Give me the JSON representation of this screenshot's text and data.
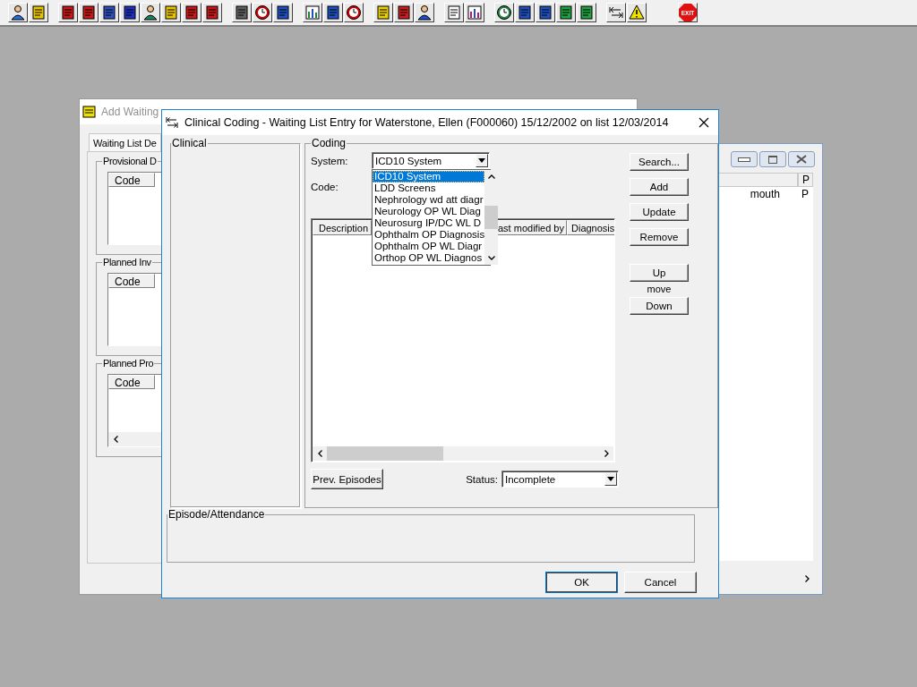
{
  "toolbar": {
    "exit_label": "EXIT"
  },
  "background_window": {
    "title": "Add Waiting",
    "tab": {
      "label": "Waiting List De",
      "selected": true
    },
    "groups": [
      {
        "title": "Provisional D",
        "column": "Code"
      },
      {
        "title": "Planned Inv",
        "column": "Code"
      },
      {
        "title": "Planned Pro",
        "column": "Code"
      }
    ]
  },
  "right_window": {
    "header": "P",
    "rows": [
      {
        "cells": [
          "mouth",
          "P"
        ]
      }
    ]
  },
  "dialog": {
    "title": "Clinical Coding - Waiting List Entry for Waterstone, Ellen (F000060) 15/12/2002 on list 12/03/2014",
    "clinical_label": "Clinical",
    "coding_label": "Coding",
    "system": {
      "label": "System:",
      "value": "ICD10 System",
      "options": [
        {
          "label": "ICD10 System",
          "selected": true
        },
        {
          "label": "LDD Screens",
          "selected": false
        },
        {
          "label": "Nephrology wd att diagr",
          "selected": false
        },
        {
          "label": "Neurology OP WL Diag",
          "selected": false
        },
        {
          "label": "Neurosurg IP/DC WL D",
          "selected": false
        },
        {
          "label": "Ophthalm OP Diagnosis",
          "selected": false
        },
        {
          "label": "Ophthalm OP WL Diagr",
          "selected": false
        },
        {
          "label": "Orthop OP WL Diagnos",
          "selected": false
        }
      ]
    },
    "code_label": "Code:",
    "table": {
      "columns": [
        "Description",
        "ast modified by",
        "Diagnosis"
      ]
    },
    "side_buttons": [
      "Search...",
      "Add",
      "Update",
      "Remove"
    ],
    "move": {
      "up": "Up",
      "label": "move",
      "down": "Down"
    },
    "prev_episodes": "Prev. Episodes",
    "status": {
      "label": "Status:",
      "value": "Incomplete"
    },
    "episode_label": "Episode/Attendance",
    "ok": "OK",
    "cancel": "Cancel"
  }
}
